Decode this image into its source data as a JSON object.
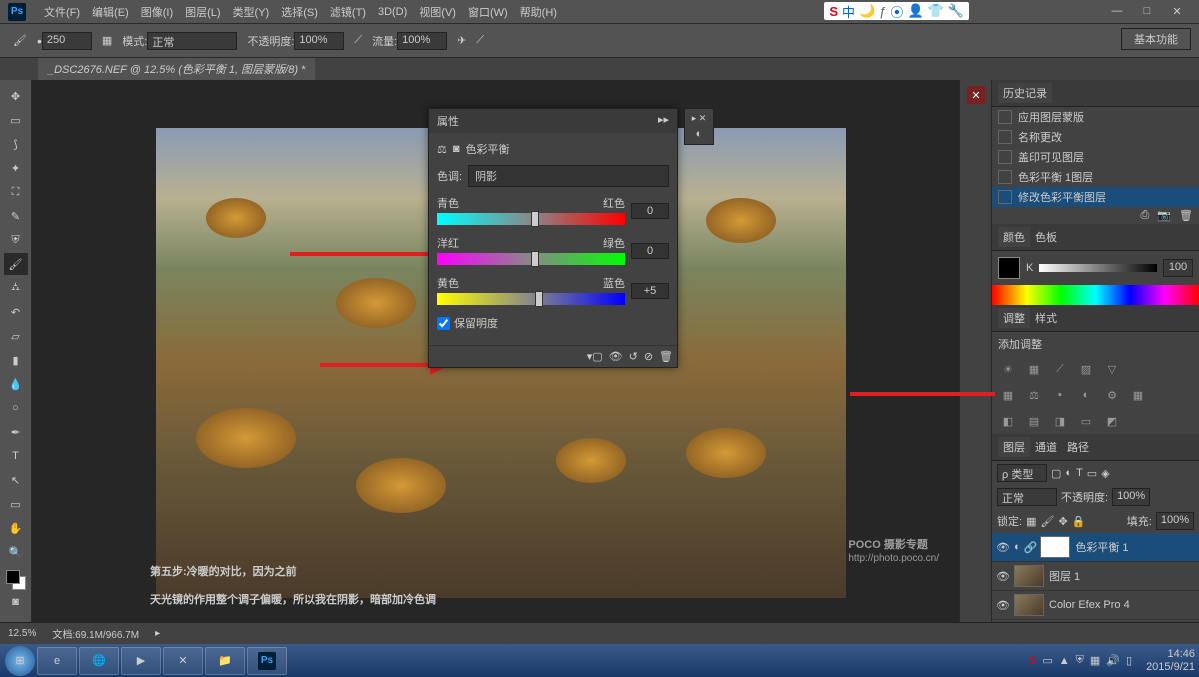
{
  "menubar": {
    "items": [
      "文件(F)",
      "编辑(E)",
      "图像(I)",
      "图层(L)",
      "类型(Y)",
      "选择(S)",
      "滤镜(T)",
      "3D(D)",
      "视图(V)",
      "窗口(W)",
      "帮助(H)"
    ]
  },
  "iconbar": {
    "items": [
      "S",
      "中",
      "🌙",
      "ƒ",
      "⦿",
      "👤",
      "👕",
      "🔧"
    ]
  },
  "optbar": {
    "brush_size": "250",
    "mode_label": "模式:",
    "mode_value": "正常",
    "opacity_label": "不透明度:",
    "opacity_value": "100%",
    "flow_label": "流量:",
    "flow_value": "100%",
    "right_label": "基本功能"
  },
  "doc_tab": "_DSC2676.NEF @ 12.5% (色彩平衡 1, 图层蒙版/8) *",
  "annotation": {
    "line1": "第五步:冷暖的对比，因为之前",
    "line2": "天光镜的作用整个调子偏暖，所以我在阴影，暗部加冷色调"
  },
  "watermark": {
    "brand": "POCO 摄影专题",
    "url": "http://photo.poco.cn/"
  },
  "props": {
    "title": "属性",
    "subtitle": "色彩平衡",
    "tone_label": "色调:",
    "tone_value": "阴影",
    "s1": {
      "left": "青色",
      "right": "红色",
      "value": "0"
    },
    "s2": {
      "left": "洋红",
      "right": "绿色",
      "value": "0"
    },
    "s3": {
      "left": "黄色",
      "right": "蓝色",
      "value": "+5"
    },
    "preserve": "保留明度"
  },
  "history": {
    "tab": "历史记录",
    "items": [
      "应用图层蒙版",
      "名称更改",
      "盖印可见图层",
      "色彩平衡 1图层",
      "修改色彩平衡图层"
    ]
  },
  "color_panel": {
    "tab1": "颜色",
    "tab2": "色板",
    "k_label": "K",
    "k_value": "100"
  },
  "adjust_panel": {
    "tab1": "调整",
    "tab2": "样式",
    "add_label": "添加调整"
  },
  "layers": {
    "tab1": "图层",
    "tab2": "通道",
    "tab3": "路径",
    "kind": "ρ 类型",
    "blend": "正常",
    "opacity_label": "不透明度:",
    "opacity": "100%",
    "lock_label": "锁定:",
    "fill_label": "填充:",
    "fill": "100%",
    "items": [
      {
        "name": "色彩平衡 1",
        "sel": true,
        "white": true
      },
      {
        "name": "图层 1",
        "sel": false,
        "white": false
      },
      {
        "name": "Color Efex Pro 4",
        "sel": false,
        "white": false
      }
    ]
  },
  "status": {
    "zoom": "12.5%",
    "doc": "文档:69.1M/966.7M"
  },
  "taskbar": {
    "time": "14:46",
    "date": "2015/9/21"
  }
}
